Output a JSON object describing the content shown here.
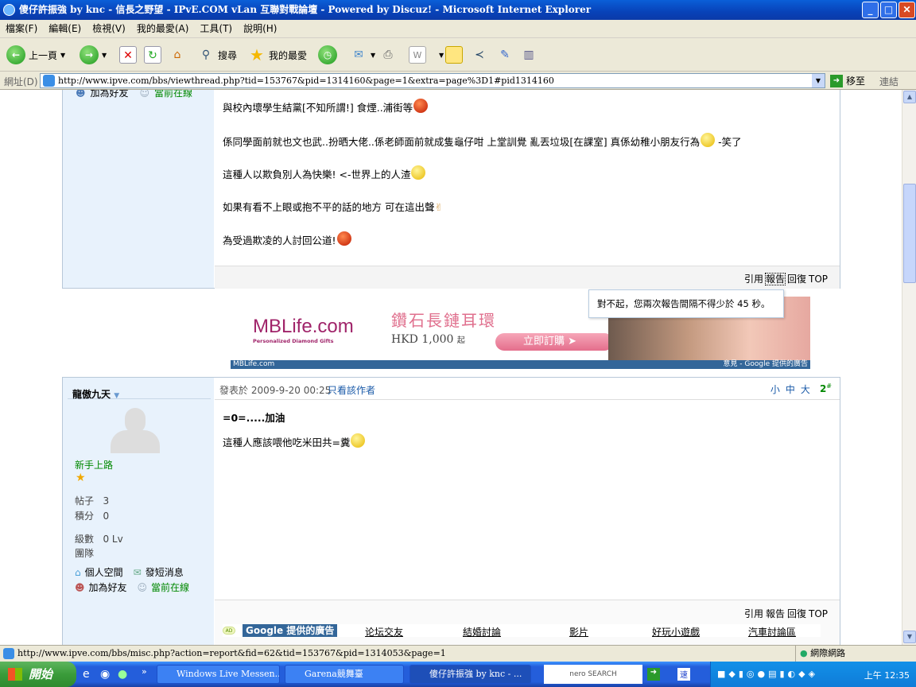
{
  "window": {
    "title": "傻仔許振強 by knc - 信長之野望 - IPvE.COM vLan 互聯對戰論壇 - Powered by Discuz! - Microsoft Internet Explorer",
    "minimize": "_",
    "maximize": "□",
    "close": "✕"
  },
  "menu": [
    "檔案(F)",
    "編輯(E)",
    "檢視(V)",
    "我的最愛(A)",
    "工具(T)",
    "說明(H)"
  ],
  "toolbar": {
    "back": "上一頁",
    "search": "搜尋",
    "favorites": "我的最愛"
  },
  "address": {
    "label": "網址(D)",
    "url": "http://www.ipve.com/bbs/viewthread.php?tid=153767&pid=1314160&page=1&extra=page%3D1#pid1314160",
    "go": "移至",
    "links": "連結"
  },
  "post1": {
    "sidebar_links": [
      "加為好友",
      "當前在線"
    ],
    "lines": [
      "與校內壞學生結黨[不知所謂!]  食煙..浦街等",
      "係同學面前就也文也武..扮晒大佬..係老師面前就成隻龜仔咁  上堂訓覺  亂丟垃圾[在課室]  真係幼稚小朋友行為",
      "這種人以欺負別人為快樂!   <-世界上的人渣",
      "如果有看不上眼或抱不平的話的地方    可在這出聲",
      "為受過欺凌的人討回公道!"
    ],
    "line1_tail": "-笑了",
    "actions": [
      "引用",
      "報告",
      "回復",
      "TOP"
    ]
  },
  "tooltip": "對不起，您兩次報告間隔不得少於 45 秒。",
  "ad": {
    "brand": "MBLife.com",
    "tagline": "Personalized  Diamond  Gifts",
    "headline": "鑽石長鏈耳環",
    "price": "HKD 1,000",
    "price_suffix": "起",
    "cta": "立即訂購",
    "footer_left": "MBLife.com",
    "footer_right": "意見 - Google 提供的廣告"
  },
  "post2": {
    "author": "龍傲九天",
    "rank": "新手上路",
    "stats": [
      {
        "label": "帖子",
        "value": "3"
      },
      {
        "label": "積分",
        "value": "0"
      },
      {
        "label": "級數",
        "value": "0 Lv"
      },
      {
        "label": "團隊",
        "value": ""
      }
    ],
    "links": [
      "個人空間",
      "發短消息",
      "加為好友",
      "當前在線"
    ],
    "posted": "發表於 2009-9-20 00:25",
    "only_author": "只看該作者",
    "font_sizes": [
      "小",
      "中",
      "大"
    ],
    "floor": "2",
    "floor_sup": "#",
    "title": "=0=.....加油",
    "body": "這種人應該喂他吃米田共=糞",
    "actions": [
      "引用",
      "報告",
      "回復",
      "TOP"
    ],
    "ad_badge": "AD",
    "ad_label": "Google 提供的廣告",
    "ad_links": [
      "论坛交友",
      "結婚討論",
      "影片",
      "好玩小遊戲",
      "汽車討論區"
    ]
  },
  "status": {
    "url": "http://www.ipve.com/bbs/misc.php?action=report&fid=62&tid=153767&pid=1314053&page=1",
    "zone": "網際網路"
  },
  "taskbar": {
    "start": "開始",
    "tasks": [
      "Windows Live Messen...",
      "Garena競舞臺",
      "傻仔許振強 by knc - ..."
    ],
    "search": "nero SEARCH",
    "clock": "上午 12:35"
  }
}
